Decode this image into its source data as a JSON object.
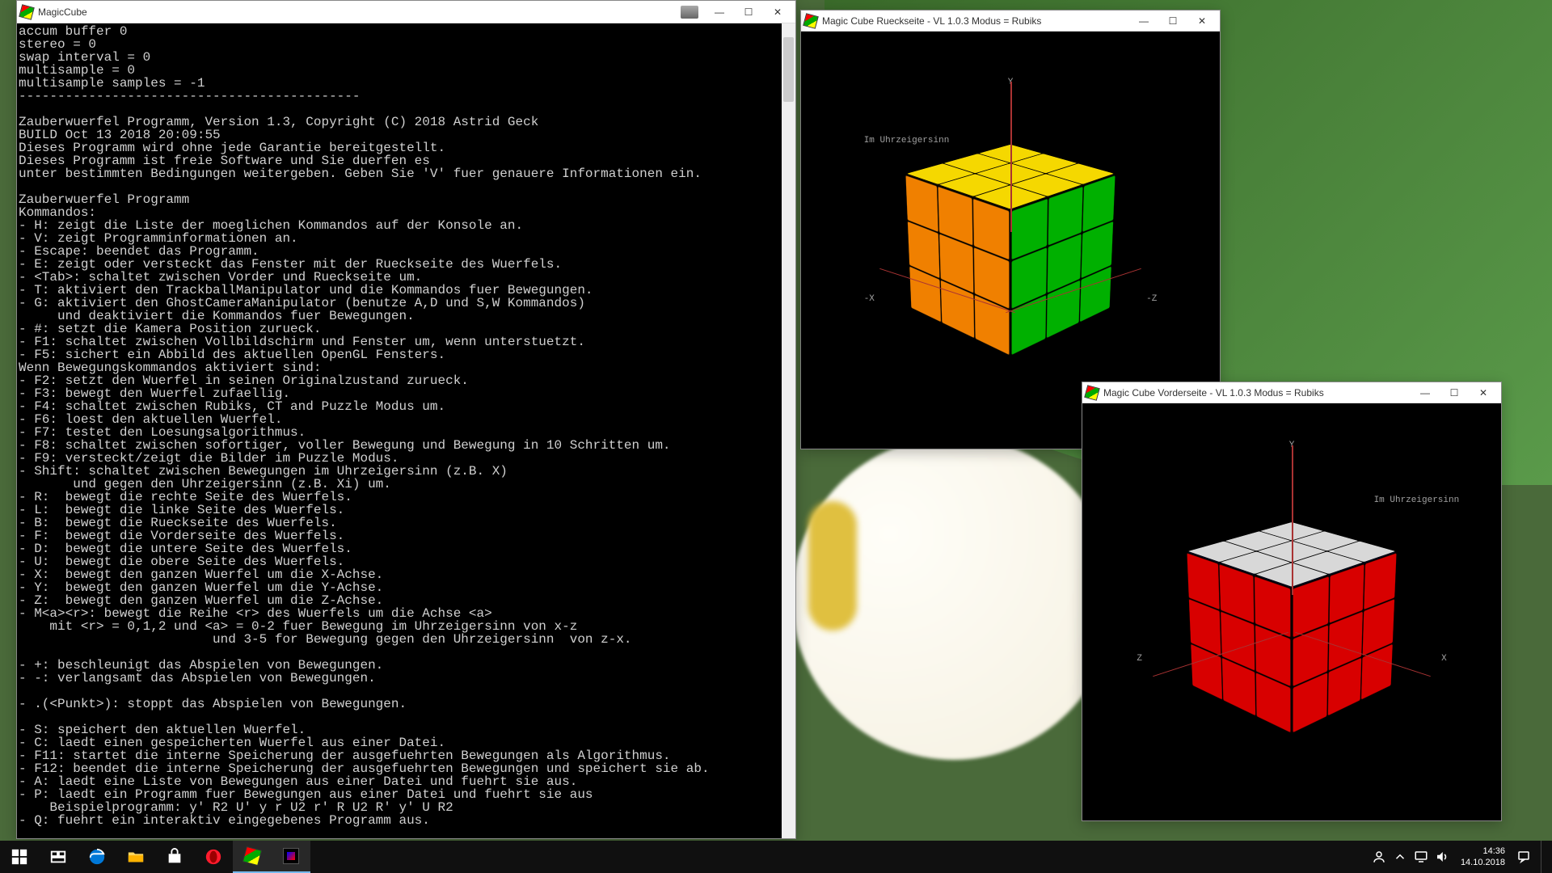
{
  "console_window": {
    "title": "MagicCube",
    "lines": [
      "accum buffer 0",
      "stereo = 0",
      "swap interval = 0",
      "multisample = 0",
      "multisample samples = -1",
      "--------------------------------------------",
      "",
      "Zauberwuerfel Programm, Version 1.3, Copyright (C) 2018 Astrid Geck",
      "BUILD Oct 13 2018 20:09:55",
      "Dieses Programm wird ohne jede Garantie bereitgestellt.",
      "Dieses Programm ist freie Software und Sie duerfen es",
      "unter bestimmten Bedingungen weitergeben. Geben Sie 'V' fuer genauere Informationen ein.",
      "",
      "Zauberwuerfel Programm",
      "Kommandos:",
      "- H: zeigt die Liste der moeglichen Kommandos auf der Konsole an.",
      "- V: zeigt Programminformationen an.",
      "- Escape: beendet das Programm.",
      "- E: zeigt oder versteckt das Fenster mit der Rueckseite des Wuerfels.",
      "- <Tab>: schaltet zwischen Vorder und Rueckseite um.",
      "- T: aktiviert den TrackballManipulator und die Kommandos fuer Bewegungen.",
      "- G: aktiviert den GhostCameraManipulator (benutze A,D und S,W Kommandos)",
      "     und deaktiviert die Kommandos fuer Bewegungen.",
      "- #: setzt die Kamera Position zurueck.",
      "- F1: schaltet zwischen Vollbildschirm und Fenster um, wenn unterstuetzt.",
      "- F5: sichert ein Abbild des aktuellen OpenGL Fensters.",
      "Wenn Bewegungskommandos aktiviert sind:",
      "- F2: setzt den Wuerfel in seinen Originalzustand zurueck.",
      "- F3: bewegt den Wuerfel zufaellig.",
      "- F4: schaltet zwischen Rubiks, CT and Puzzle Modus um.",
      "- F6: loest den aktuellen Wuerfel.",
      "- F7: testet den Loesungsalgorithmus.",
      "- F8: schaltet zwischen sofortiger, voller Bewegung und Bewegung in 10 Schritten um.",
      "- F9: versteckt/zeigt die Bilder im Puzzle Modus.",
      "- Shift: schaltet zwischen Bewegungen im Uhrzeigersinn (z.B. X)",
      "       und gegen den Uhrzeigersinn (z.B. Xi) um.",
      "- R:  bewegt die rechte Seite des Wuerfels.",
      "- L:  bewegt die linke Seite des Wuerfels.",
      "- B:  bewegt die Rueckseite des Wuerfels.",
      "- F:  bewegt die Vorderseite des Wuerfels.",
      "- D:  bewegt die untere Seite des Wuerfels.",
      "- U:  bewegt die obere Seite des Wuerfels.",
      "- X:  bewegt den ganzen Wuerfel um die X-Achse.",
      "- Y:  bewegt den ganzen Wuerfel um die Y-Achse.",
      "- Z:  bewegt den ganzen Wuerfel um die Z-Achse.",
      "- M<a><r>: bewegt die Reihe <r> des Wuerfels um die Achse <a>",
      "    mit <r> = 0,1,2 und <a> = 0-2 fuer Bewegung im Uhrzeigersinn von x-z",
      "                         und 3-5 for Bewegung gegen den Uhrzeigersinn  von z-x.",
      "",
      "- +: beschleunigt das Abspielen von Bewegungen.",
      "- -: verlangsamt das Abspielen von Bewegungen.",
      "",
      "- .(<Punkt>): stoppt das Abspielen von Bewegungen.",
      "",
      "- S: speichert den aktuellen Wuerfel.",
      "- C: laedt einen gespeicherten Wuerfel aus einer Datei.",
      "- F11: startet die interne Speicherung der ausgefuehrten Bewegungen als Algorithmus.",
      "- F12: beendet die interne Speicherung der ausgefuehrten Bewegungen und speichert sie ab.",
      "- A: laedt eine Liste von Bewegungen aus einer Datei und fuehrt sie aus.",
      "- P: laedt ein Programm fuer Bewegungen aus einer Datei und fuehrt sie aus",
      "    Beispielprogramm: y' R2 U' y r U2 r' R U2 R' y' U R2",
      "- Q: fuehrt ein interaktiv eingegebenes Programm aus."
    ]
  },
  "rear_window": {
    "title": "Magic Cube Rueckseite - VL 1.0.3 Modus = Rubiks",
    "direction_label": "Im Uhrzeigersinn",
    "axes": {
      "x": "-X",
      "y": "Y",
      "z": "-Z"
    },
    "face_colors": {
      "top": "#f5d800",
      "left": "#f08000",
      "right": "#00b000"
    }
  },
  "front_window": {
    "title": "Magic Cube Vorderseite - VL 1.0.3 Modus = Rubiks",
    "direction_label": "Im Uhrzeigersinn",
    "axes": {
      "x": "X",
      "y": "Y",
      "z": "Z"
    },
    "face_colors": {
      "top": "#d8d8d8",
      "left": "#0020e0",
      "right": "#d80000"
    }
  },
  "taskbar": {
    "clock_time": "14:36",
    "clock_date": "14.10.2018"
  },
  "titlebar_buttons": {
    "min": "—",
    "max": "☐",
    "close": "✕"
  }
}
